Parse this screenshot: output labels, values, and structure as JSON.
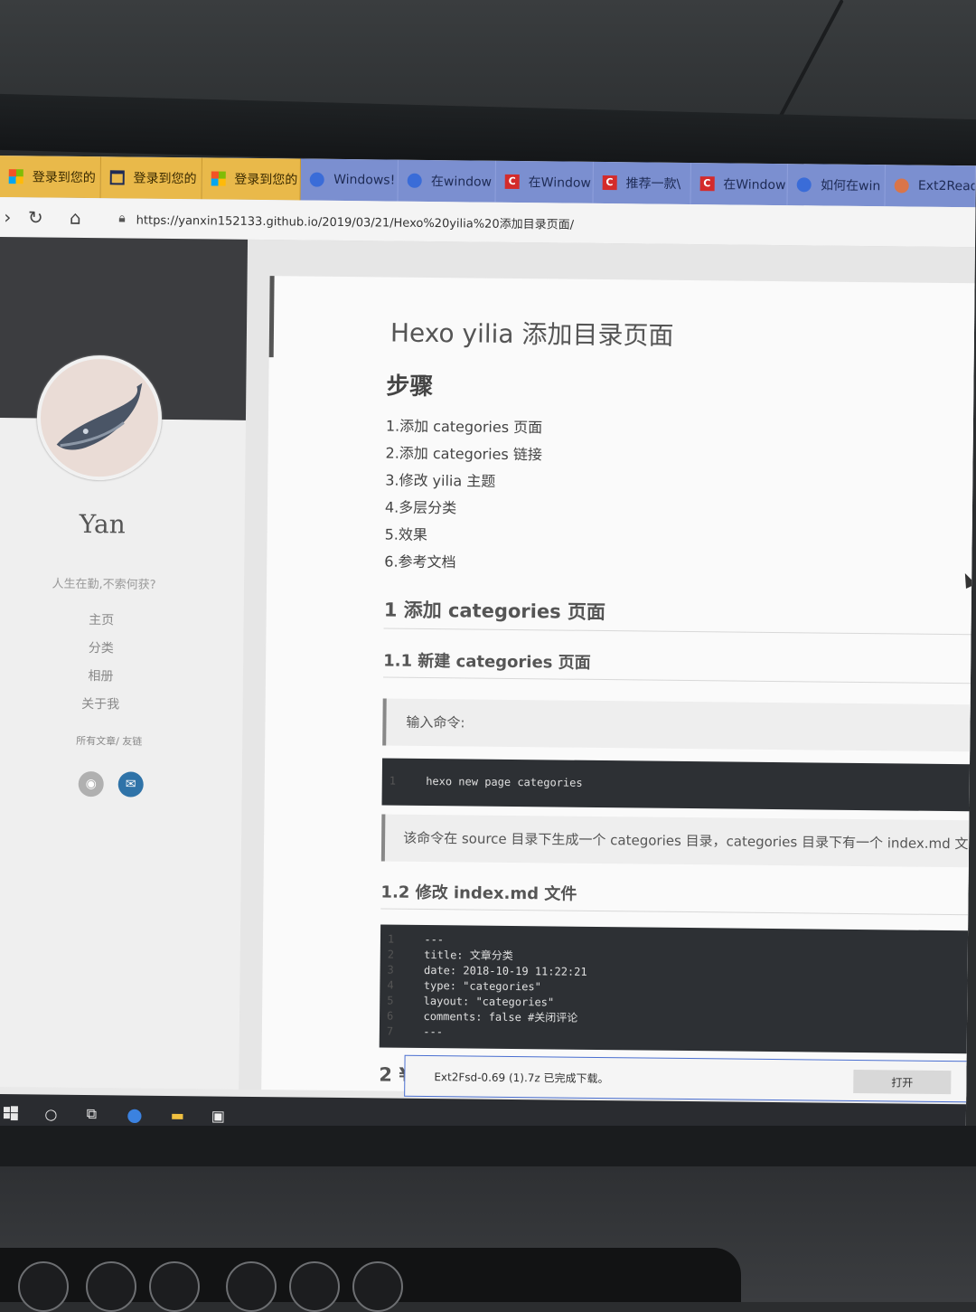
{
  "tabs": [
    {
      "label": "登录到您的",
      "icon": "microsoft-logo-icon",
      "highlight": true
    },
    {
      "label": "登录到您的",
      "icon": "window-icon",
      "highlight": true
    },
    {
      "label": "登录到您的",
      "icon": "microsoft-logo-icon",
      "highlight": true
    },
    {
      "label": "Windows!",
      "icon": "baidu-paw-icon",
      "highlight": false
    },
    {
      "label": "在window",
      "icon": "baidu-paw-icon",
      "highlight": false
    },
    {
      "label": "在Window",
      "icon": "csdn-icon",
      "highlight": false
    },
    {
      "label": "推荐一款\\",
      "icon": "csdn-icon",
      "highlight": false
    },
    {
      "label": "在Window",
      "icon": "csdn-icon",
      "highlight": false
    },
    {
      "label": "如何在win",
      "icon": "baidu-paw-icon",
      "highlight": false
    },
    {
      "label": "Ext2Read",
      "icon": "orange-site-icon",
      "highlight": false
    }
  ],
  "address": {
    "url": "https://yanxin152133.github.io/2019/03/21/Hexo%20yilia%20添加目录页面/"
  },
  "sidebar": {
    "author": "Yan",
    "motto": "人生在勤,不索何获?",
    "nav": [
      "主页",
      "分类",
      "相册",
      "关于我"
    ],
    "links": "所有文章/ 友链"
  },
  "article": {
    "title": "Hexo yilia 添加目录页面",
    "steps_heading": "步骤",
    "toc": [
      "1.添加 categories 页面",
      "2.添加 categories 链接",
      "3.修改 yilia 主题",
      "4.多层分类",
      "5.效果",
      "6.参考文档"
    ],
    "h2_1": "1 添加 categories 页面",
    "h3_1": "1.1 新建 categories 页面",
    "quote_1": "输入命令:",
    "code_1": [
      "hexo new page categories"
    ],
    "quote_2": "该命令在 source 目录下生成一个 categories 目录，categories 目录下有一个 index.md 文",
    "h3_2": "1.2 修改 index.md 文件",
    "code_2": [
      "---",
      "title: 文章分类",
      "date: 2018-10-19 11:22:21",
      "type: \"categories\"",
      "layout: \"categories\"",
      "comments: false #关闭评论",
      "---"
    ],
    "h2_2_partial": "2 ¥"
  },
  "download": {
    "text": "Ext2Fsd-0.69 (1).7z 已完成下载。",
    "open_label": "打开"
  },
  "colors": {
    "tabbar": "#7b8fd0",
    "highlight_tab": "#e9b94a",
    "code_bg": "#2d3034",
    "sidebar_dark": "#3c3d40",
    "github": "#b0b0b0",
    "mail": "#2f73a8"
  }
}
